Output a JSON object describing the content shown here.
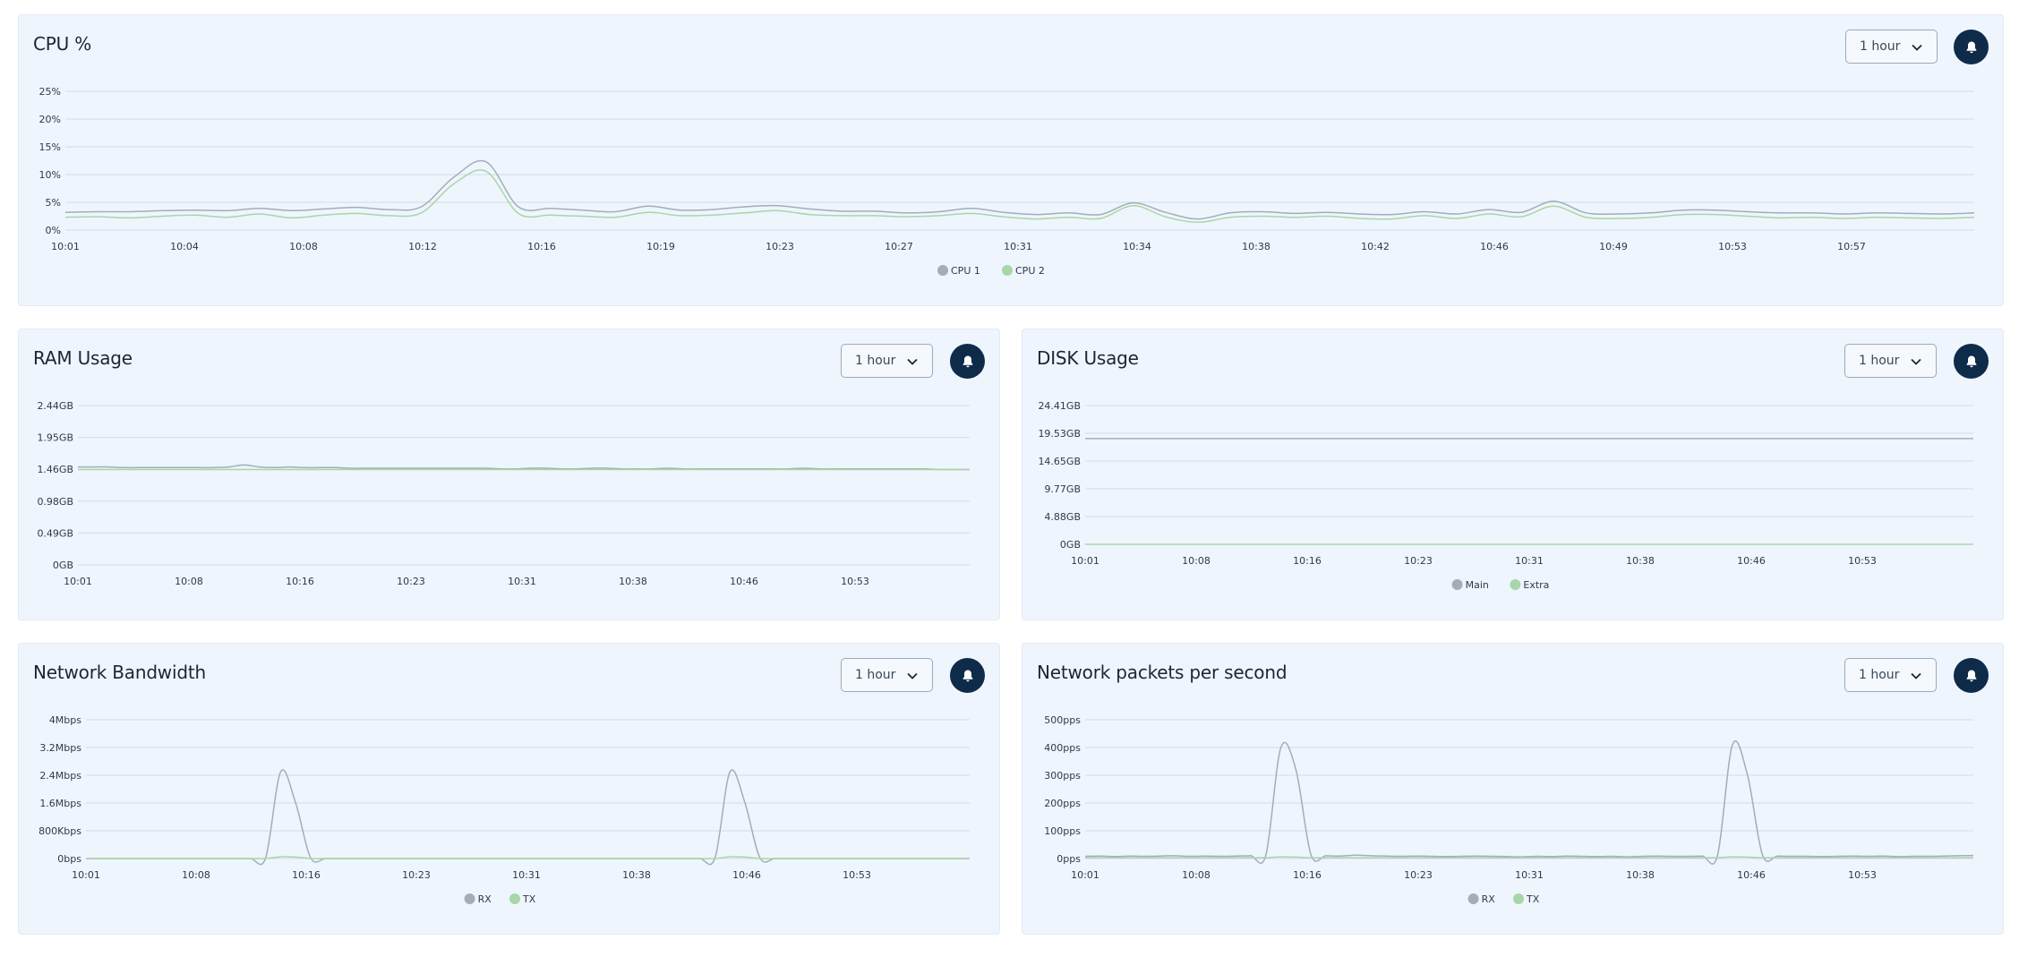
{
  "panels": {
    "cpu": {
      "title": "CPU %",
      "range_label": "1 hour",
      "alert_icon": "bell-icon",
      "chart_data": {
        "type": "line",
        "title": "",
        "xlabel": "",
        "ylabel": "",
        "y_tick_labels": [
          "0%",
          "5%",
          "10%",
          "15%",
          "20%",
          "25%"
        ],
        "ylim": [
          0,
          25
        ],
        "x_tick_labels": [
          "10:01",
          "10:04",
          "10:08",
          "10:12",
          "10:16",
          "10:19",
          "10:23",
          "10:27",
          "10:31",
          "10:34",
          "10:38",
          "10:42",
          "10:46",
          "10:49",
          "10:53",
          "10:57"
        ],
        "x": [
          0,
          1,
          2,
          3,
          4,
          5,
          6,
          7,
          8,
          9,
          10,
          11,
          12,
          13,
          14,
          15,
          16,
          17,
          18,
          19,
          20,
          21,
          22,
          23,
          24,
          25,
          26,
          27,
          28,
          29,
          30,
          31,
          32,
          33,
          34,
          35,
          36,
          37,
          38,
          39,
          40,
          41,
          42,
          43,
          44,
          45,
          46,
          47,
          48,
          49,
          50,
          51,
          52,
          53,
          54,
          55,
          56,
          57,
          58,
          59
        ],
        "legend_position": "bottom-center",
        "grid": true,
        "series": [
          {
            "name": "CPU 1",
            "color": "#a3adb8",
            "values": [
              3.2,
              3.3,
              3.3,
              3.5,
              3.6,
              3.5,
              3.9,
              3.5,
              3.8,
              4.1,
              3.7,
              4.2,
              9.5,
              12.3,
              4.2,
              3.9,
              3.6,
              3.3,
              4.3,
              3.6,
              3.7,
              4.2,
              4.4,
              3.8,
              3.4,
              3.4,
              3.1,
              3.3,
              3.9,
              3.2,
              2.8,
              3.1,
              2.8,
              4.9,
              3.2,
              2.0,
              3.1,
              3.3,
              3.0,
              3.2,
              2.9,
              2.8,
              3.3,
              2.9,
              3.7,
              3.2,
              5.2,
              3.1,
              2.9,
              3.1,
              3.6,
              3.6,
              3.3,
              3.1,
              3.1,
              2.9,
              3.1,
              3.0,
              2.9,
              3.1
            ]
          },
          {
            "name": "CPU 2",
            "color": "#a8d6a8",
            "values": [
              2.3,
              2.4,
              2.2,
              2.5,
              2.7,
              2.3,
              2.9,
              2.2,
              2.7,
              3.0,
              2.6,
              3.1,
              8.3,
              10.6,
              3.0,
              2.7,
              2.5,
              2.3,
              3.2,
              2.6,
              2.7,
              3.1,
              3.5,
              2.8,
              2.6,
              2.6,
              2.4,
              2.6,
              3.0,
              2.4,
              2.0,
              2.3,
              2.1,
              4.4,
              2.4,
              1.4,
              2.3,
              2.5,
              2.3,
              2.5,
              2.1,
              2.0,
              2.6,
              2.1,
              2.9,
              2.4,
              4.3,
              2.3,
              2.1,
              2.3,
              2.8,
              2.8,
              2.5,
              2.2,
              2.3,
              2.1,
              2.3,
              2.2,
              2.1,
              2.3
            ]
          }
        ]
      }
    },
    "ram": {
      "title": "RAM Usage",
      "range_label": "1 hour",
      "alert_icon": "bell-icon",
      "chart_data": {
        "type": "line",
        "title": "",
        "xlabel": "",
        "ylabel": "",
        "y_tick_labels": [
          "0GB",
          "0.49GB",
          "0.98GB",
          "1.46GB",
          "1.95GB",
          "2.44GB"
        ],
        "ylim": [
          0,
          2.44
        ],
        "x_tick_labels": [
          "10:01",
          "10:08",
          "10:16",
          "10:23",
          "10:31",
          "10:38",
          "10:46",
          "10:53"
        ],
        "x": [
          0,
          1,
          2,
          3,
          4,
          5,
          6,
          7,
          8,
          9,
          10,
          11,
          12,
          13,
          14,
          15,
          16,
          17,
          18,
          19,
          20,
          21,
          22,
          23,
          24,
          25,
          26,
          27,
          28,
          29,
          30,
          31,
          32,
          33,
          34,
          35,
          36,
          37,
          38,
          39,
          40,
          41,
          42,
          43,
          44,
          45,
          46,
          47,
          48,
          49,
          50,
          51,
          52,
          53,
          54,
          55,
          56,
          57,
          58,
          59
        ],
        "grid": true,
        "series": [
          {
            "name": "",
            "color": "#a3adb8",
            "values": [
              1.5,
              1.5,
              1.5,
              1.49,
              1.49,
              1.49,
              1.49,
              1.49,
              1.49,
              1.49,
              1.5,
              1.53,
              1.5,
              1.49,
              1.5,
              1.49,
              1.49,
              1.49,
              1.48,
              1.48,
              1.48,
              1.48,
              1.48,
              1.48,
              1.48,
              1.48,
              1.48,
              1.48,
              1.47,
              1.47,
              1.48,
              1.48,
              1.47,
              1.47,
              1.48,
              1.48,
              1.47,
              1.47,
              1.47,
              1.48,
              1.47,
              1.47,
              1.47,
              1.47,
              1.47,
              1.47,
              1.47,
              1.47,
              1.48,
              1.47,
              1.47,
              1.47,
              1.47,
              1.47,
              1.47,
              1.47,
              1.47,
              1.46,
              1.46,
              1.46
            ]
          },
          {
            "name": "",
            "color": "#a8d6a8",
            "values": [
              1.46,
              1.46,
              1.46,
              1.46,
              1.46,
              1.46,
              1.46,
              1.46,
              1.46,
              1.46,
              1.46,
              1.46,
              1.46,
              1.46,
              1.46,
              1.46,
              1.46,
              1.46,
              1.46,
              1.46,
              1.46,
              1.46,
              1.46,
              1.46,
              1.46,
              1.46,
              1.46,
              1.46,
              1.46,
              1.46,
              1.46,
              1.46,
              1.46,
              1.46,
              1.46,
              1.46,
              1.46,
              1.46,
              1.46,
              1.46,
              1.46,
              1.46,
              1.46,
              1.46,
              1.46,
              1.46,
              1.46,
              1.46,
              1.46,
              1.46,
              1.46,
              1.46,
              1.46,
              1.46,
              1.46,
              1.46,
              1.46,
              1.46,
              1.46,
              1.46
            ]
          }
        ]
      }
    },
    "disk": {
      "title": "DISK Usage",
      "range_label": "1 hour",
      "alert_icon": "bell-icon",
      "chart_data": {
        "type": "line",
        "title": "",
        "xlabel": "",
        "ylabel": "",
        "y_tick_labels": [
          "0GB",
          "4.88GB",
          "9.77GB",
          "14.65GB",
          "19.53GB",
          "24.41GB"
        ],
        "ylim": [
          0,
          24.41
        ],
        "x_tick_labels": [
          "10:01",
          "10:08",
          "10:16",
          "10:23",
          "10:31",
          "10:38",
          "10:46",
          "10:53"
        ],
        "x": [
          0,
          59
        ],
        "legend_position": "bottom-center",
        "grid": true,
        "series": [
          {
            "name": "Main",
            "color": "#a3adb8",
            "values": [
              18.6,
              18.6
            ]
          },
          {
            "name": "Extra",
            "color": "#a8d6a8",
            "values": [
              0,
              0
            ]
          }
        ]
      }
    },
    "bandwidth": {
      "title": "Network Bandwidth",
      "range_label": "1 hour",
      "alert_icon": "bell-icon",
      "chart_data": {
        "type": "line",
        "title": "",
        "xlabel": "",
        "ylabel": "",
        "y_tick_labels": [
          "0bps",
          "800Kbps",
          "1.6Mbps",
          "2.4Mbps",
          "3.2Mbps",
          "4Mbps"
        ],
        "ylim": [
          0,
          4
        ],
        "y_unit": "Mbps",
        "x_tick_labels": [
          "10:01",
          "10:08",
          "10:16",
          "10:23",
          "10:31",
          "10:38",
          "10:46",
          "10:53"
        ],
        "x": [
          0,
          1,
          2,
          3,
          4,
          5,
          6,
          7,
          8,
          9,
          10,
          11,
          12,
          13,
          14,
          15,
          16,
          17,
          18,
          19,
          20,
          21,
          22,
          23,
          24,
          25,
          26,
          27,
          28,
          29,
          30,
          31,
          32,
          33,
          34,
          35,
          36,
          37,
          38,
          39,
          40,
          41,
          42,
          43,
          44,
          45,
          46,
          47,
          48,
          49,
          50,
          51,
          52,
          53,
          54,
          55,
          56,
          57,
          58,
          59
        ],
        "legend_position": "bottom-center",
        "grid": true,
        "series": [
          {
            "name": "RX",
            "color": "#a3adb8",
            "values": [
              0,
              0,
              0,
              0,
              0,
              0,
              0,
              0,
              0,
              0,
              0,
              0,
              0.02,
              2.5,
              1.6,
              0.02,
              0,
              0,
              0,
              0,
              0,
              0,
              0,
              0,
              0,
              0,
              0,
              0,
              0,
              0,
              0,
              0,
              0,
              0,
              0,
              0,
              0,
              0,
              0,
              0,
              0,
              0,
              0.02,
              2.5,
              1.6,
              0.02,
              0,
              0,
              0,
              0,
              0,
              0,
              0,
              0,
              0,
              0,
              0,
              0,
              0,
              0
            ]
          },
          {
            "name": "TX",
            "color": "#a8d6a8",
            "values": [
              0,
              0,
              0,
              0,
              0,
              0,
              0,
              0,
              0,
              0,
              0,
              0,
              0,
              0.05,
              0.04,
              0,
              0,
              0,
              0,
              0,
              0,
              0,
              0,
              0,
              0,
              0,
              0,
              0,
              0,
              0,
              0,
              0,
              0,
              0,
              0,
              0,
              0,
              0,
              0,
              0,
              0,
              0,
              0,
              0.05,
              0.04,
              0,
              0,
              0,
              0,
              0,
              0,
              0,
              0,
              0,
              0,
              0,
              0,
              0,
              0,
              0
            ]
          }
        ]
      }
    },
    "packets": {
      "title": "Network packets per second",
      "range_label": "1 hour",
      "alert_icon": "bell-icon",
      "chart_data": {
        "type": "line",
        "title": "",
        "xlabel": "",
        "ylabel": "",
        "y_tick_labels": [
          "0pps",
          "100pps",
          "200pps",
          "300pps",
          "400pps",
          "500pps"
        ],
        "ylim": [
          0,
          500
        ],
        "x_tick_labels": [
          "10:01",
          "10:08",
          "10:16",
          "10:23",
          "10:31",
          "10:38",
          "10:46",
          "10:53"
        ],
        "x": [
          0,
          1,
          2,
          3,
          4,
          5,
          6,
          7,
          8,
          9,
          10,
          11,
          12,
          13,
          14,
          15,
          16,
          17,
          18,
          19,
          20,
          21,
          22,
          23,
          24,
          25,
          26,
          27,
          28,
          29,
          30,
          31,
          32,
          33,
          34,
          35,
          36,
          37,
          38,
          39,
          40,
          41,
          42,
          43,
          44,
          45,
          46,
          47,
          48,
          49,
          50,
          51,
          52,
          53,
          54,
          55,
          56,
          57,
          58,
          59
        ],
        "legend_position": "bottom-center",
        "grid": true,
        "series": [
          {
            "name": "RX",
            "color": "#a3adb8",
            "values": [
              8,
              9,
              7,
              9,
              8,
              9,
              10,
              8,
              9,
              8,
              9,
              10,
              12,
              400,
              320,
              14,
              10,
              9,
              12,
              10,
              9,
              8,
              9,
              8,
              7,
              8,
              9,
              8,
              7,
              6,
              8,
              7,
              9,
              8,
              7,
              8,
              6,
              8,
              9,
              8,
              8,
              9,
              10,
              410,
              300,
              12,
              9,
              8,
              8,
              7,
              8,
              9,
              8,
              9,
              7,
              8,
              8,
              9,
              10,
              11
            ]
          },
          {
            "name": "TX",
            "color": "#a8d6a8",
            "values": [
              3,
              3,
              3,
              3,
              3,
              3,
              3,
              3,
              3,
              3,
              3,
              3,
              3,
              6,
              5,
              3,
              3,
              3,
              3,
              3,
              3,
              3,
              3,
              3,
              3,
              3,
              3,
              3,
              3,
              3,
              3,
              3,
              3,
              3,
              3,
              3,
              3,
              3,
              3,
              3,
              3,
              3,
              3,
              6,
              5,
              3,
              3,
              3,
              3,
              3,
              3,
              3,
              3,
              3,
              3,
              3,
              3,
              3,
              3,
              3
            ]
          }
        ]
      }
    }
  }
}
